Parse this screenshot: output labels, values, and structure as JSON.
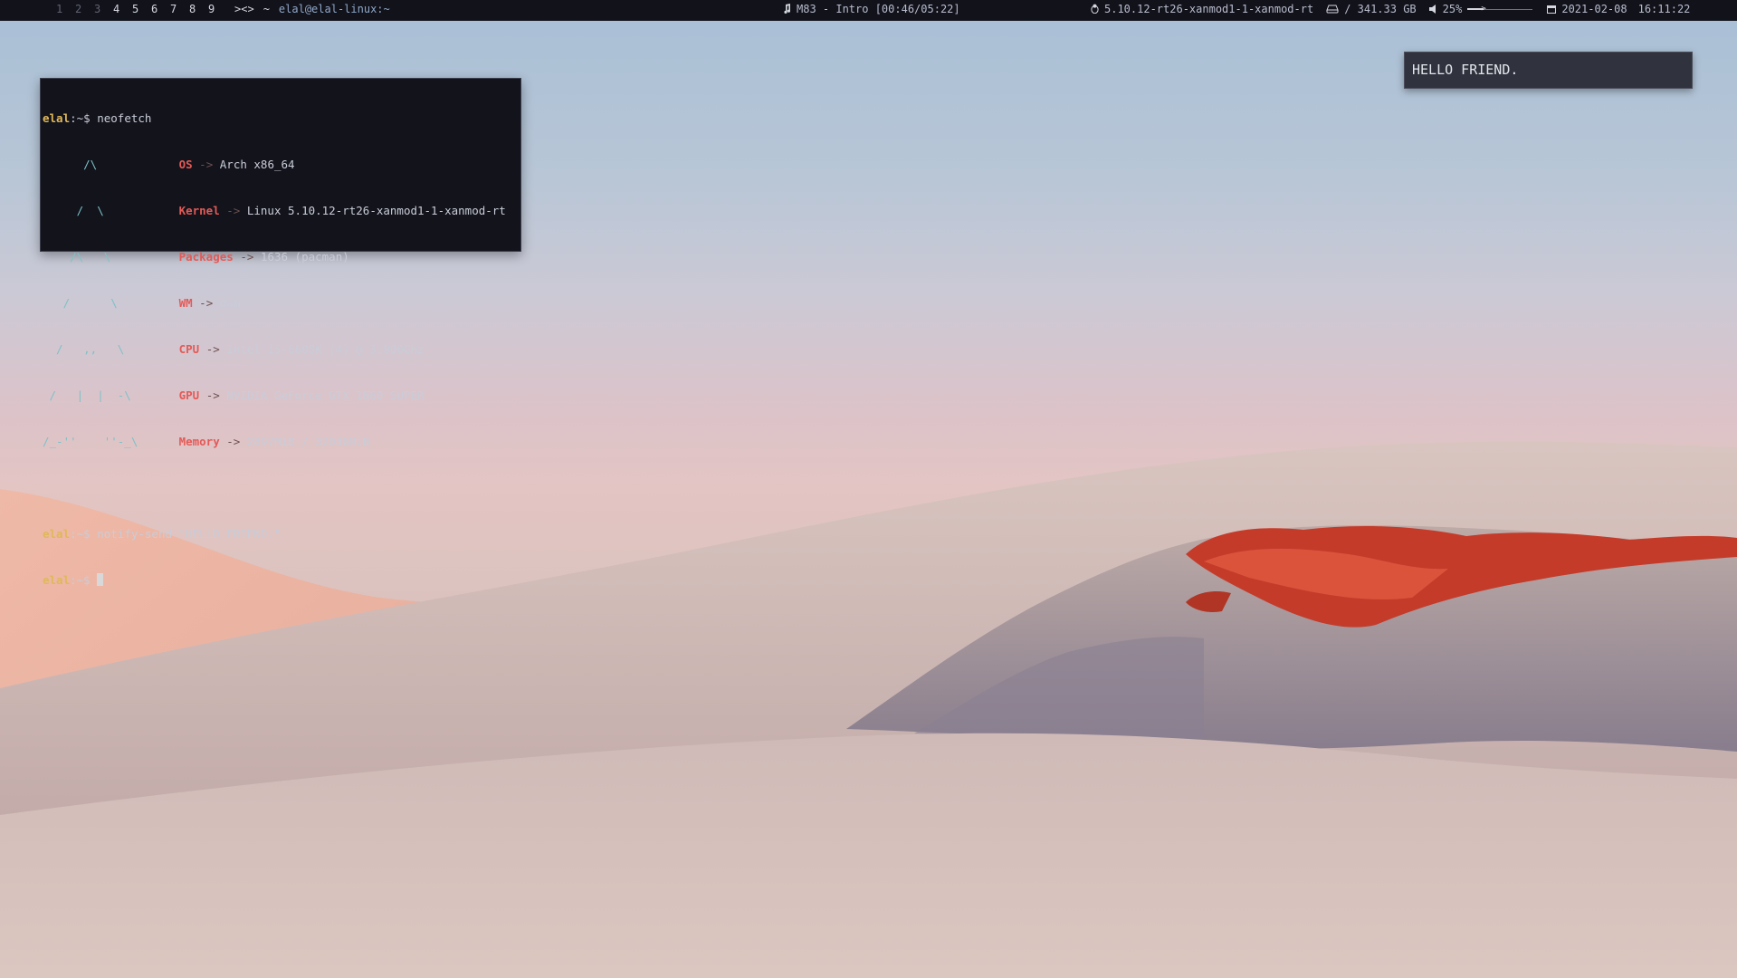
{
  "bar": {
    "tags": [
      {
        "label": "1",
        "occupied": false
      },
      {
        "label": "2",
        "occupied": false
      },
      {
        "label": "3",
        "occupied": false
      },
      {
        "label": "4",
        "occupied": true
      },
      {
        "label": "5",
        "occupied": true
      },
      {
        "label": "6",
        "occupied": true
      },
      {
        "label": "7",
        "occupied": true
      },
      {
        "label": "8",
        "occupied": true
      },
      {
        "label": "9",
        "occupied": true
      }
    ],
    "layout_symbol": "><>",
    "tilde": "~",
    "window_title": "elal@elal-linux:~",
    "music_icon": "music-note-icon",
    "music": "M83 - Intro [00:46/05:22]",
    "kernel_icon": "tux-icon",
    "kernel": "5.10.12-rt26-xanmod1-1-xanmod-rt",
    "disk_icon": "hard-drive-icon",
    "disk": "/ 341.33 GB",
    "volume_icon": "speaker-icon",
    "volume_label": "25%",
    "volume_fraction": 0.25,
    "calendar_icon": "calendar-icon",
    "date": "2021-02-08",
    "time": "16:11:22"
  },
  "terminal": {
    "cmd1_user": "elal",
    "cmd1_prompt": ":~$ ",
    "cmd1": "neofetch",
    "art": [
      "      /\\",
      "     /  \\",
      "    /\\   \\",
      "   /      \\",
      "  /   ,,   \\",
      " /   |  |  -\\",
      "/_-''    ''-_\\"
    ],
    "info": [
      {
        "key": "OS",
        "value": "Arch x86_64"
      },
      {
        "key": "Kernel",
        "value": "Linux 5.10.12-rt26-xanmod1-1-xanmod-rt"
      },
      {
        "key": "Packages",
        "value": "1636 (pacman)"
      },
      {
        "key": "WM",
        "value": "dwm"
      },
      {
        "key": "CPU",
        "value": "Intel i5-6600K (4) @ 3.900GHz"
      },
      {
        "key": "GPU",
        "value": "NVIDIA GeForce GTX 1660 SUPER"
      },
      {
        "key": "Memory",
        "value": "2897MiB / 32036MiB"
      }
    ],
    "separator": "->",
    "cmd2_user": "elal",
    "cmd2_prompt": ":~$ ",
    "cmd2": "notify-send \"HELLO FRIEND.\"",
    "cmd3_user": "elal",
    "cmd3_prompt": ":~$ "
  },
  "notification": {
    "text": "HELLO FRIEND."
  },
  "colors": {
    "bar_bg": "#11121a",
    "prompt_user": "#e0b85a",
    "info_key": "#e45a57",
    "logo": "#7dc2c8",
    "notification_bg": "#30323d"
  }
}
